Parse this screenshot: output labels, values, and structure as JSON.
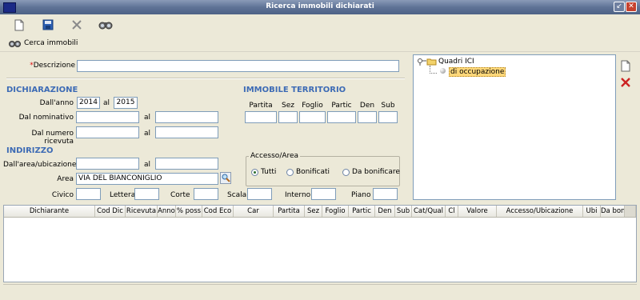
{
  "window": {
    "title": "Ricerca immobili dichiarati"
  },
  "toolbar": {
    "icons": [
      "new-document-icon",
      "save-icon",
      "delete-icon",
      "binoculars-icon"
    ]
  },
  "search_link": {
    "label": "Cerca immobili"
  },
  "form": {
    "descrizione": {
      "label": "Descrizione",
      "required_mark": "*",
      "value": ""
    },
    "dichiarazione": {
      "title": "DICHIARAZIONE",
      "anno_label": "Dall'anno",
      "anno_from": "2014",
      "al": "al",
      "anno_to": "2015",
      "nominativo_label": "Dal nominativo",
      "ricevuta_label": "Dal numero ricevuta"
    },
    "immobile": {
      "title": "IMMOBILE TERRITORIO",
      "headers": [
        "Partita",
        "Sez",
        "Foglio",
        "Partic",
        "Den",
        "Sub"
      ]
    },
    "indirizzo": {
      "title": "INDIRIZZO",
      "area_ubicazione_label": "Dall'area/ubicazione",
      "area_label": "Area",
      "area_value": "VIA DEL BIANCONIGLIO",
      "civico_label": "Civico",
      "lettera_label": "Lettera",
      "corte_label": "Corte",
      "scala_label": "Scala",
      "interno_label": "Interno",
      "piano_label": "Piano"
    },
    "accesso": {
      "title": "Accesso/Area",
      "options": [
        {
          "label": "Tutti",
          "selected": true
        },
        {
          "label": "Bonificati",
          "selected": false
        },
        {
          "label": "Da bonificare",
          "selected": false
        }
      ]
    }
  },
  "tree": {
    "root": "Quadri ICI",
    "child": "di occupazione"
  },
  "grid": {
    "columns": [
      "Dichiarante",
      "Cod Dic",
      "Ricevuta",
      "Anno",
      "% poss",
      "Cod Eco",
      "Car",
      "Partita",
      "Sez",
      "Foglio",
      "Partic",
      "Den",
      "Sub",
      "Cat/Qual",
      "Cl",
      "Valore",
      "Accesso/Ubicazione",
      "Ubi",
      "Da bon"
    ]
  },
  "colors": {
    "section": "#3d6bb5",
    "required": "#d11111",
    "delete_red": "#cc2222"
  }
}
